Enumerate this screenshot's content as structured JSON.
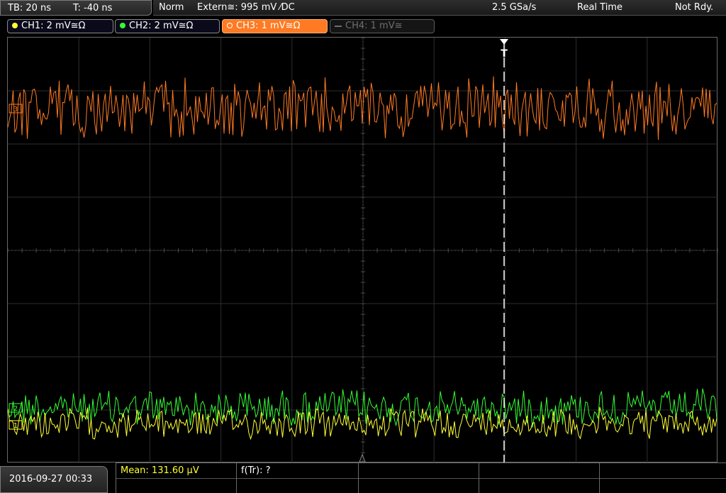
{
  "topbar": {
    "timebase": "TB: 20 ns",
    "trigger_offset": "T: -40 ns",
    "mode": "Norm",
    "trigger_source": "Extern≅: 995 mV ⁄DC",
    "sample_rate": "2.5 GSa/s",
    "acq_mode": "Real Time",
    "status": "Not Rdy."
  },
  "channels": [
    {
      "label": "CH1: 2 mV≅Ω",
      "color": "#ffff33",
      "state": "on"
    },
    {
      "label": "CH2: 2 mV≅Ω",
      "color": "#33ff33",
      "state": "on"
    },
    {
      "label": "CH3: 1 mV≅Ω",
      "color": "#ff7a22",
      "state": "selected"
    },
    {
      "label": "CH4: 1 mV≅",
      "color": "#6e6e6e",
      "state": "off"
    }
  ],
  "screen": {
    "trigger_marker": "T",
    "ch3_marker": "3",
    "ch2_marker": "2",
    "ch1_marker": "1"
  },
  "bottom": {
    "datetime": "2016-09-27 00:33",
    "measurements": [
      {
        "label": "Mean: 131.60 µV",
        "color": "#ffff33"
      },
      {
        "label": "f(Tr): ?",
        "color": "#ffffff"
      }
    ]
  }
}
